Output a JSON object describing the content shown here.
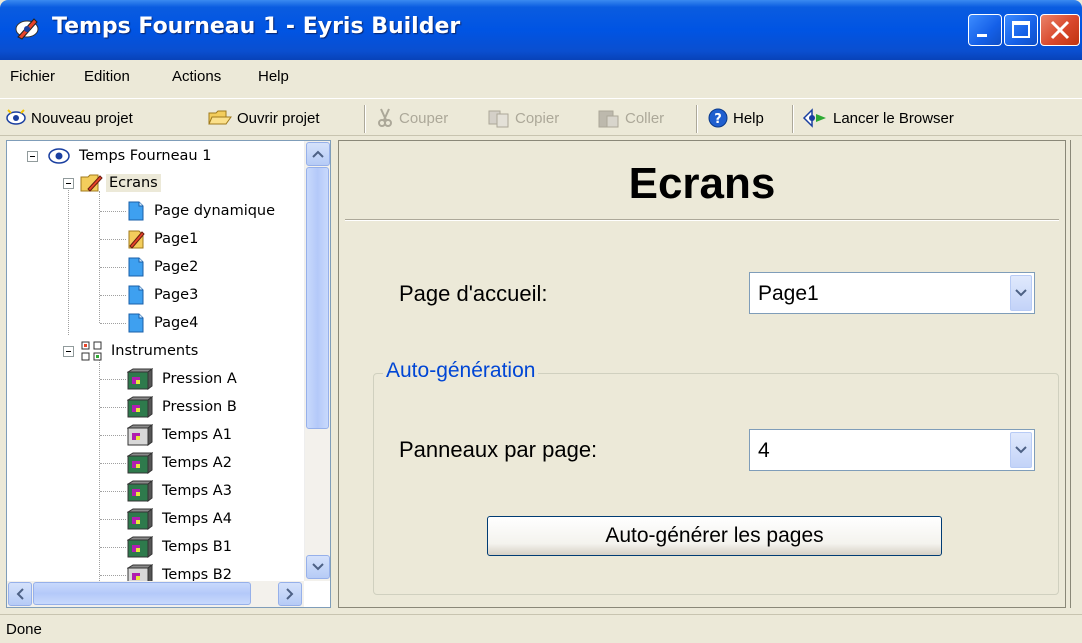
{
  "window": {
    "title": "Temps Fourneau 1 - Eyris Builder"
  },
  "menu": [
    "Fichier",
    "Edition",
    "Actions",
    "Help"
  ],
  "toolbar": {
    "new_project": "Nouveau projet",
    "open_project": "Ouvrir projet",
    "cut": "Couper",
    "copy": "Copier",
    "paste": "Coller",
    "help": "Help",
    "launch_browser": "Lancer le Browser"
  },
  "tree": {
    "root": "Temps Fourneau 1",
    "screens_folder": "Ecrans",
    "pages": [
      "Page dynamique",
      "Page1",
      "Page2",
      "Page3",
      "Page4"
    ],
    "instruments_folder": "Instruments",
    "instruments": [
      "Pression A",
      "Pression B",
      "Temps A1",
      "Temps A2",
      "Temps A3",
      "Temps A4",
      "Temps B1",
      "Temps B2"
    ]
  },
  "main": {
    "heading": "Ecrans",
    "home_page_label": "Page d'accueil:",
    "home_page_value": "Page1",
    "group_title": "Auto-génération",
    "panels_label": "Panneaux par page:",
    "panels_value": "4",
    "generate_button": "Auto-générer les pages"
  },
  "status": "Done",
  "colors": {
    "titlebar": "#0054e3",
    "group_title": "#0046d5",
    "face": "#ece9d8"
  }
}
